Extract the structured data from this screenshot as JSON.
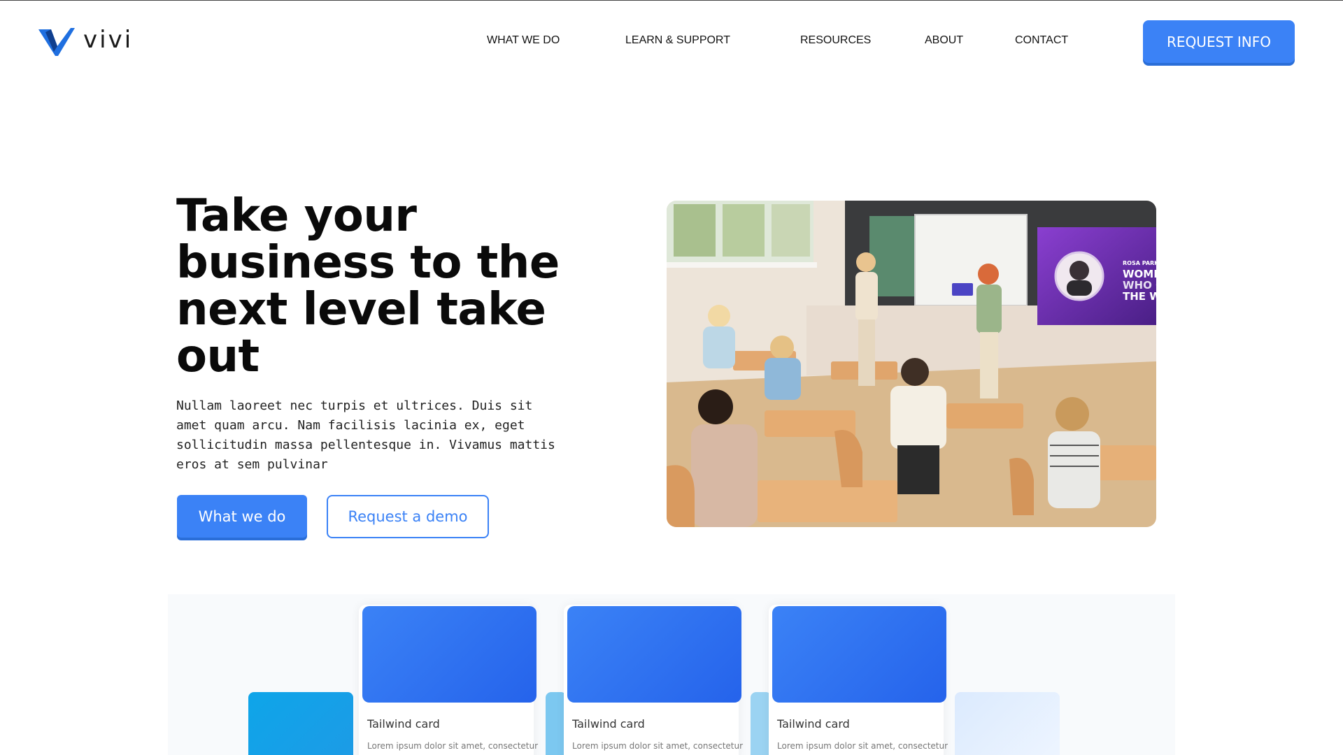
{
  "header": {
    "logo_text": "vivi",
    "nav": [
      {
        "label": "WHAT WE DO"
      },
      {
        "label": "LEARN & SUPPORT"
      },
      {
        "label": "RESOURCES"
      },
      {
        "label": "ABOUT"
      },
      {
        "label": "CONTACT"
      }
    ],
    "cta_label": "REQUEST INFO"
  },
  "hero": {
    "title": "Take your business to the next level take out",
    "text": "Nullam laoreet nec turpis et ultrices. Duis sit amet quam arcu. Nam facilisis lacinia ex, eget sollicitudin massa pellentesque in. Vivamus mattis eros at sem pulvinar",
    "primary_button": "What we do",
    "secondary_button": "Request a demo",
    "photo_screen": {
      "line1": "ROSA PARKS",
      "line2": "WOME",
      "line3": "WHO C",
      "line4": "THE W"
    }
  },
  "cards": [
    {
      "title": "Tailwind card",
      "text": "Lorem ipsum dolor sit amet, consectetur"
    },
    {
      "title": "Tailwind card",
      "text": "Lorem ipsum dolor sit amet, consectetur"
    },
    {
      "title": "Tailwind card",
      "text": "Lorem ipsum dolor sit amet, consectetur"
    }
  ],
  "colors": {
    "accent": "#3b82f6",
    "accent_dark": "#2563eb"
  },
  "icons": {
    "logo": "vivi-check-logo-icon"
  }
}
